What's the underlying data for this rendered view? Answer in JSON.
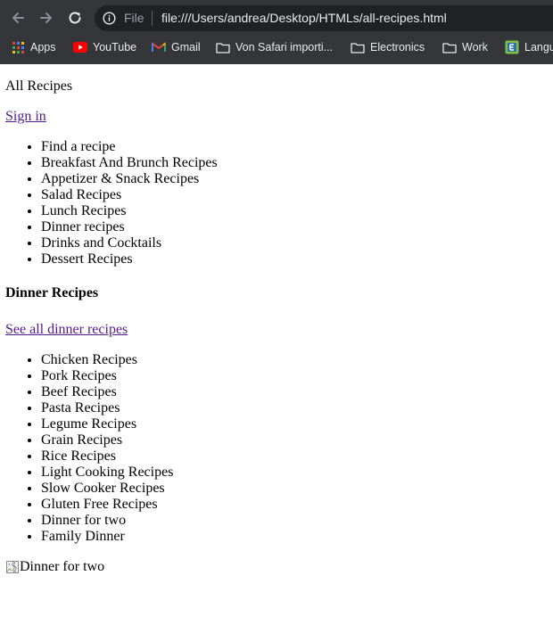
{
  "browser": {
    "omnibox": {
      "scheme": "File",
      "url": "file:///Users/andrea/Desktop/HTMLs/all-recipes.html"
    },
    "bookmarks": {
      "apps": "Apps",
      "youtube": "YouTube",
      "gmail": "Gmail",
      "vonsafari": "Von Safari importi...",
      "electronics": "Electronics",
      "work": "Work",
      "langu": "Langu"
    }
  },
  "page": {
    "site_title": "All Recipes",
    "signin": "Sign in",
    "nav": [
      "Find a recipe",
      "Breakfast And Brunch Recipes",
      "Appetizer & Snack Recipes",
      "Salad Recipes",
      "Lunch Recipes",
      "Dinner recipes",
      "Drinks and Cocktails",
      "Dessert Recipes"
    ],
    "section_heading": "Dinner Recipes",
    "see_all": "See all dinner recipes",
    "dinner": [
      "Chicken Recipes",
      "Pork Recipes",
      "Beef Recipes",
      "Pasta Recipes",
      "Legume Recipes",
      "Grain Recipes",
      "Rice Recipes",
      "Light Cooking Recipes",
      "Slow Cooker Recipes",
      "Gluten Free Recipes",
      "Dinner for two",
      "Family Dinner"
    ],
    "image_alt": "Dinner for two"
  }
}
